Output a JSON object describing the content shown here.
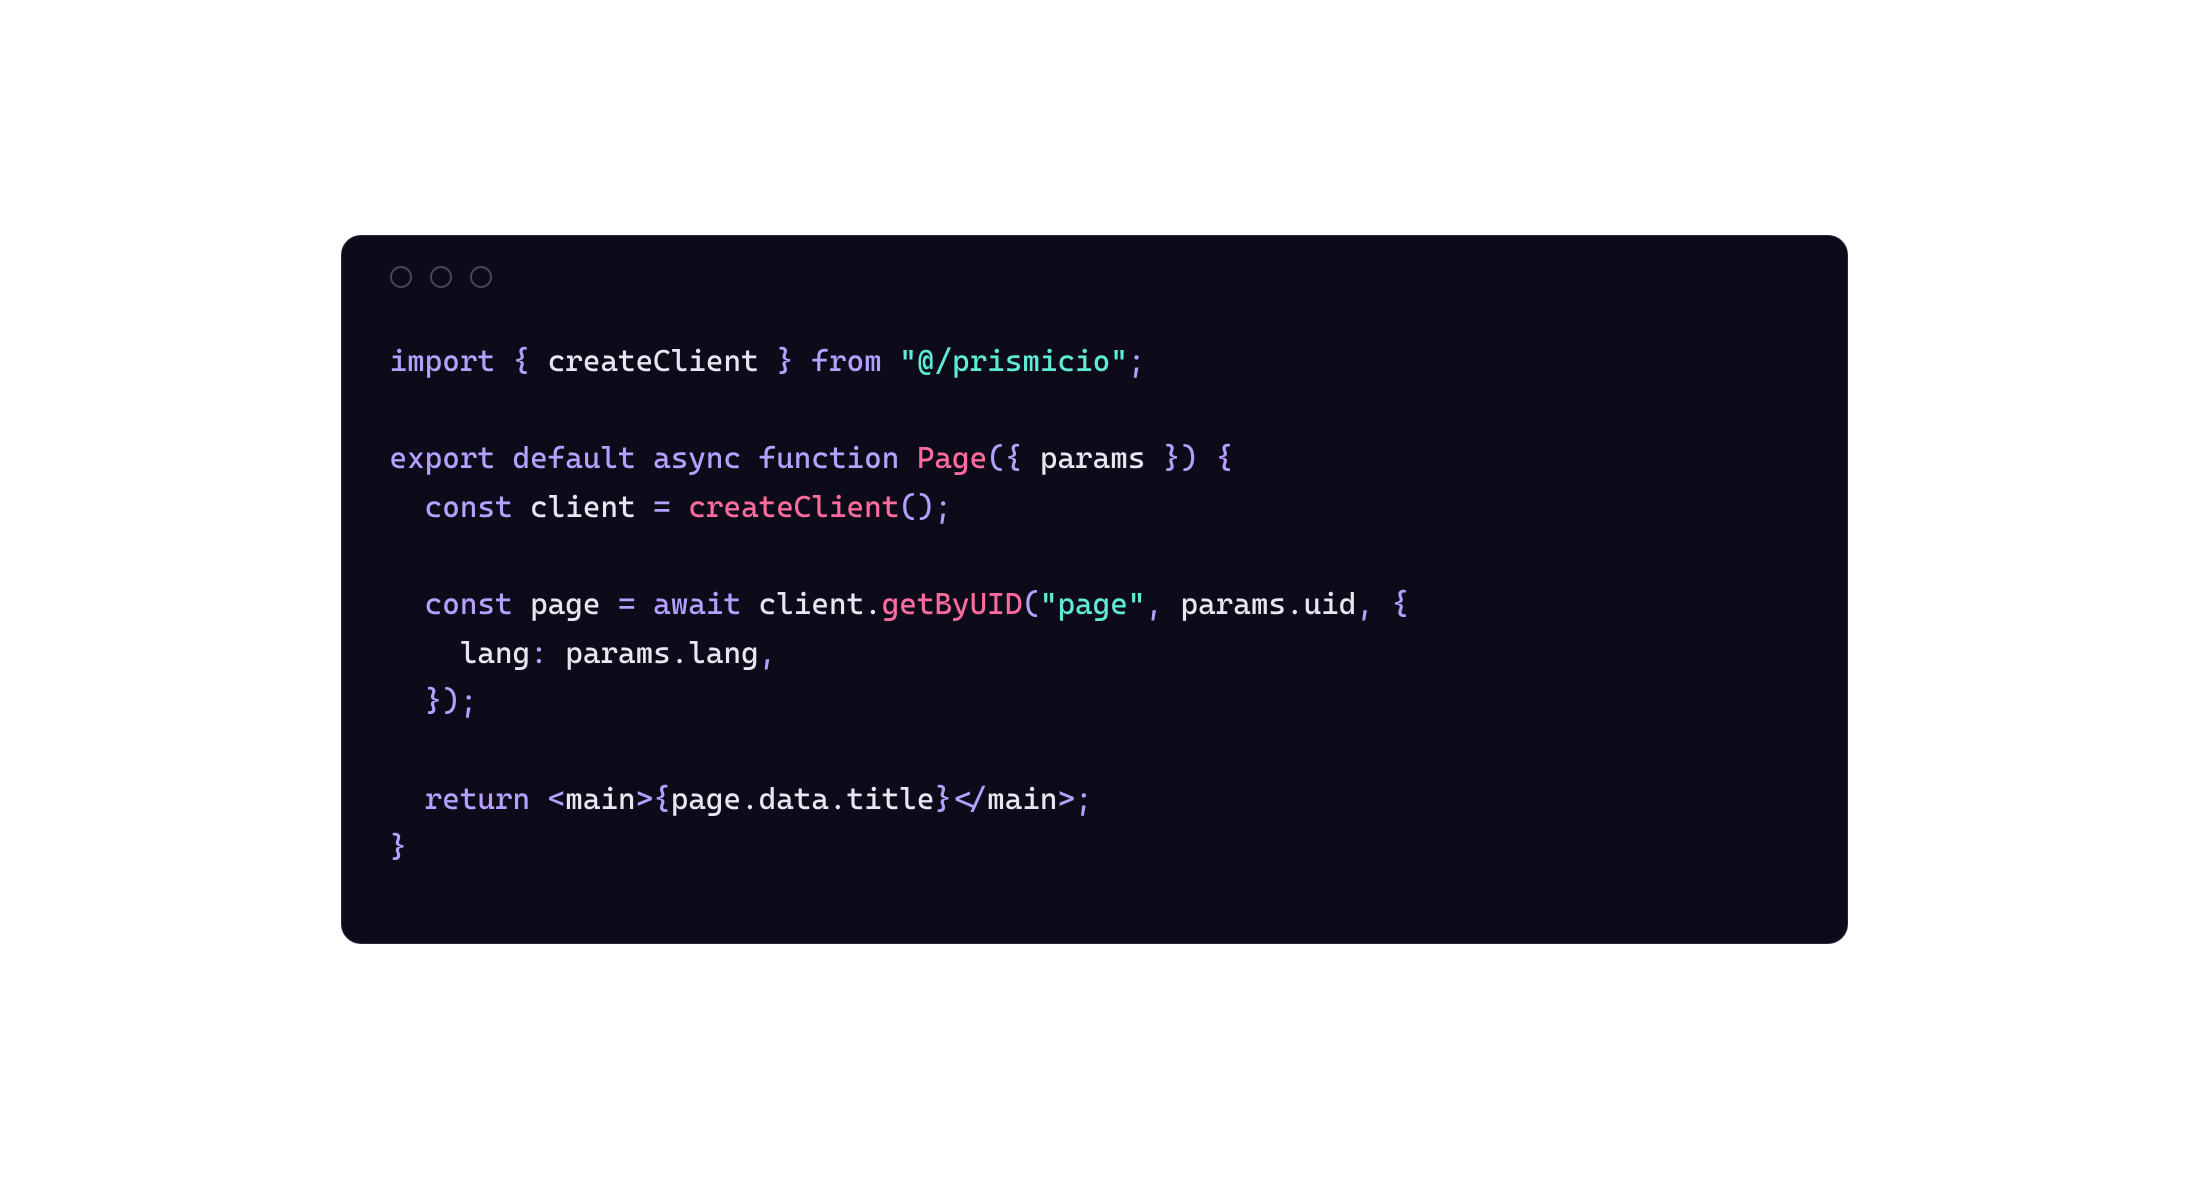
{
  "code": {
    "tokens": {
      "import": "import",
      "export": "export",
      "default": "default",
      "async": "async",
      "function": "function",
      "const": "const",
      "await": "await",
      "return": "return",
      "from": "from",
      "createClient": "createClient",
      "prismicio_path": "\"@/prismicio\"",
      "Page": "Page",
      "params": "params",
      "client": "client",
      "page": "page",
      "getByUID": "getByUID",
      "page_string": "\"page\"",
      "uid": "uid",
      "lang": "lang",
      "main": "main",
      "data": "data",
      "title": "title",
      "open_brace": "{",
      "close_brace": "}",
      "open_paren": "(",
      "close_paren": ")",
      "open_angle": "<",
      "close_angle": ">",
      "slash": "/",
      "semi": ";",
      "comma": ",",
      "equals": "=",
      "colon": ":",
      "dot": "."
    }
  }
}
